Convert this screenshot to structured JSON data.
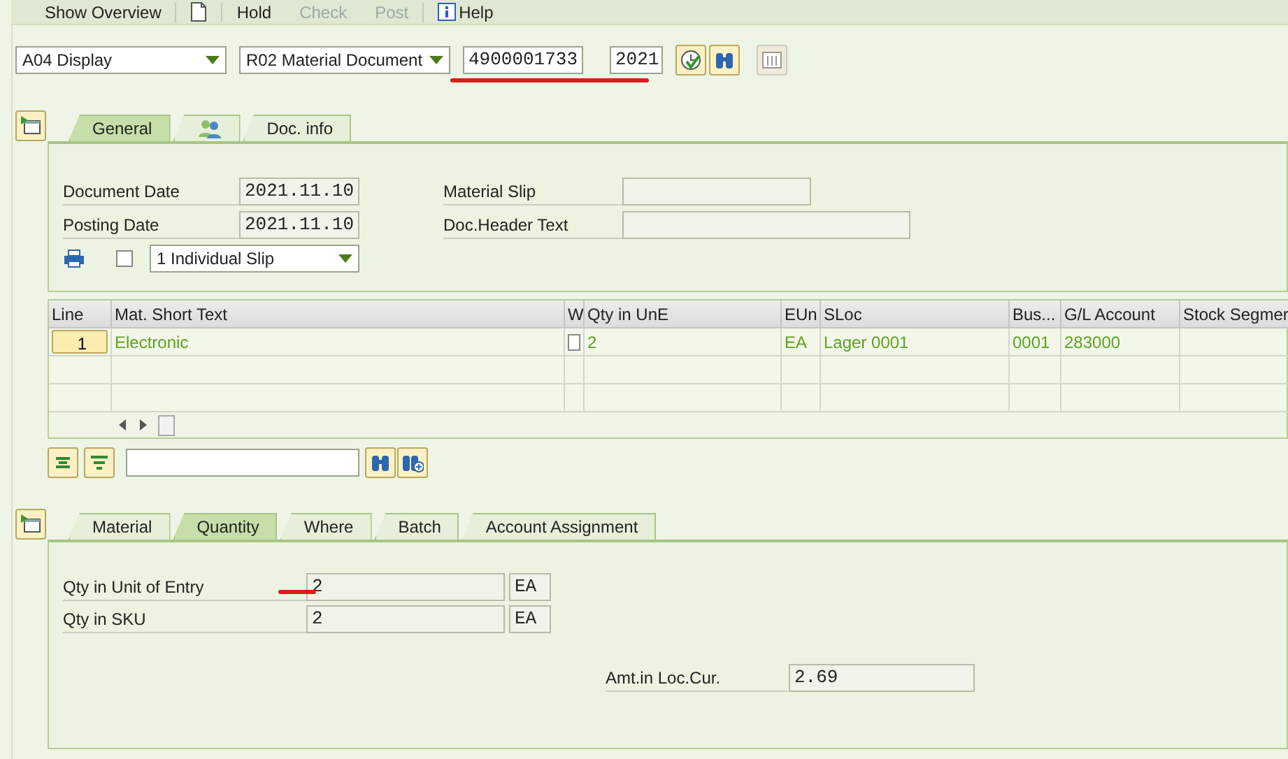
{
  "toolbar": [
    {
      "kind": "button",
      "label": "Show Overview",
      "disabled": false
    },
    {
      "kind": "page"
    },
    {
      "kind": "button",
      "label": "Hold",
      "disabled": false
    },
    {
      "kind": "button",
      "label": "Check",
      "disabled": true
    },
    {
      "kind": "button",
      "label": "Post",
      "disabled": true
    },
    {
      "kind": "help",
      "label": "Help",
      "disabled": false
    }
  ],
  "header": {
    "action": "A04 Display",
    "reference": "R02 Material Document",
    "document_number": "4900001733",
    "year": "2021",
    "underlined": true
  },
  "header_tabs": [
    {
      "kind": "text",
      "label": "General",
      "selected": true
    },
    {
      "kind": "icon",
      "selected": false
    },
    {
      "kind": "text",
      "label": "Doc. info",
      "selected": false
    }
  ],
  "general": {
    "left_fields": [
      {
        "label": "Document Date",
        "value": "2021.11.10"
      },
      {
        "label": "Posting Date",
        "value": "2021.11.10"
      }
    ],
    "right_fields": [
      {
        "label": "Material Slip"
      },
      {
        "label": "Doc.Header Text"
      }
    ],
    "print_checked": false,
    "slip_version": "1 Individual Slip"
  },
  "table": {
    "columns": [
      "Line",
      "Mat. Short Text",
      "W",
      "Qty in UnE",
      "EUn",
      "SLoc",
      "Bus...",
      "G/L Account",
      "Stock Segmer"
    ],
    "rows": [
      {
        "cells": [
          {
            "kind": "line",
            "value": "1"
          },
          {
            "kind": "text",
            "value": "Electronic"
          },
          {
            "kind": "check",
            "checked": false
          },
          {
            "kind": "text",
            "value": "2"
          },
          {
            "kind": "text",
            "value": "EA"
          },
          {
            "kind": "text",
            "value": "Lager 0001"
          },
          {
            "kind": "text",
            "value": "0001"
          },
          {
            "kind": "text",
            "value": "283000"
          },
          {
            "kind": "blank"
          }
        ]
      }
    ]
  },
  "item_tabs": [
    {
      "label": "Material",
      "selected": false
    },
    {
      "label": "Quantity",
      "selected": true
    },
    {
      "label": "Where",
      "selected": false
    },
    {
      "label": "Batch",
      "selected": false
    },
    {
      "label": "Account Assignment",
      "selected": false
    }
  ],
  "quantity": {
    "fields": [
      {
        "label": "Qty in Unit of Entry",
        "value": "2",
        "unit": "EA",
        "underlined": true
      },
      {
        "label": "Qty in SKU",
        "value": "2",
        "unit": "EA",
        "underlined": false
      }
    ],
    "amount": {
      "label": "Amt.in Loc.Cur.",
      "value": "2.69"
    }
  }
}
